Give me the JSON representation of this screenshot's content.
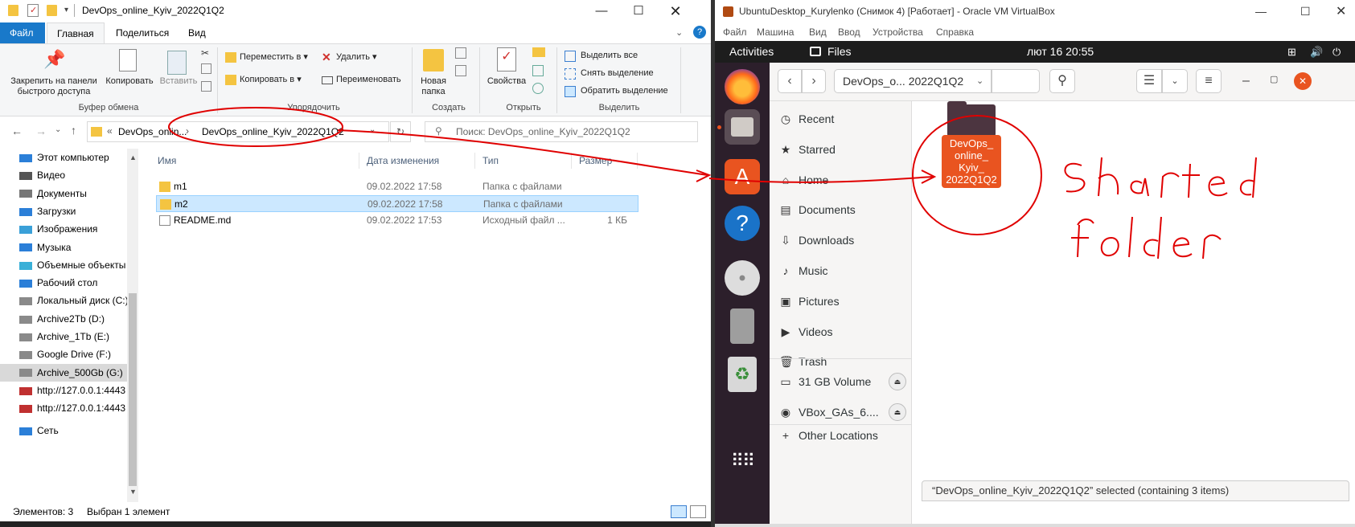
{
  "explorer": {
    "title": "DevOps_online_Kyiv_2022Q1Q2",
    "menu_tabs": [
      "Файл",
      "Главная",
      "Поделиться",
      "Вид"
    ],
    "ribbon": {
      "pin_label_1": "Закрепить на панели",
      "pin_label_2": "быстрого доступа",
      "copy_label": "Копировать",
      "paste_label": "Вставить",
      "move_to": "Переместить в",
      "copy_to": "Копировать в",
      "delete": "Удалить",
      "rename": "Переименовать",
      "new_folder_1": "Новая",
      "new_folder_2": "папка",
      "properties": "Свойства",
      "select_all": "Выделить все",
      "deselect": "Снять выделение",
      "invert": "Обратить выделение",
      "group_clipboard": "Буфер обмена",
      "group_organize": "Упорядочить",
      "group_create": "Создать",
      "group_open": "Открыть",
      "group_select": "Выделить"
    },
    "address": {
      "crumb_1": "DevOps_onlin...",
      "crumb_2": "DevOps_online_Kyiv_2022Q1Q2",
      "search_placeholder": "Поиск: DevOps_online_Kyiv_2022Q1Q2"
    },
    "nav_items": [
      {
        "label": "Этот компьютер",
        "icon": "computer-icon"
      },
      {
        "label": "Видео",
        "icon": "video-icon"
      },
      {
        "label": "Документы",
        "icon": "documents-icon"
      },
      {
        "label": "Загрузки",
        "icon": "downloads-icon"
      },
      {
        "label": "Изображения",
        "icon": "pictures-icon"
      },
      {
        "label": "Музыка",
        "icon": "music-icon"
      },
      {
        "label": "Объемные объекты",
        "icon": "3d-icon"
      },
      {
        "label": "Рабочий стол",
        "icon": "desktop-icon"
      },
      {
        "label": "Локальный диск (C:)",
        "icon": "drive-icon"
      },
      {
        "label": "Archive2Tb (D:)",
        "icon": "drive-icon"
      },
      {
        "label": "Archive_1Tb (E:)",
        "icon": "drive-icon"
      },
      {
        "label": "Google Drive (F:)",
        "icon": "drive-icon"
      },
      {
        "label": "Archive_500Gb (G:)",
        "icon": "drive-icon"
      },
      {
        "label": "http://127.0.0.1:4443",
        "icon": "network-drive-icon"
      },
      {
        "label": "http://127.0.0.1:4443",
        "icon": "network-drive-icon"
      },
      {
        "label": "Сеть",
        "icon": "network-icon"
      }
    ],
    "columns": [
      "Имя",
      "Дата изменения",
      "Тип",
      "Размер"
    ],
    "files": [
      {
        "name": "m1",
        "date": "09.02.2022 17:58",
        "type": "Папка с файлами",
        "size": "",
        "icon": "folder-icon"
      },
      {
        "name": "m2",
        "date": "09.02.2022 17:58",
        "type": "Папка с файлами",
        "size": "",
        "icon": "folder-icon"
      },
      {
        "name": "README.md",
        "date": "09.02.2022 17:53",
        "type": "Исходный файл ...",
        "size": "1 КБ",
        "icon": "file-icon"
      }
    ],
    "status_items": "Элементов: 3",
    "status_selected": "Выбран 1 элемент"
  },
  "vbox": {
    "title": "UbuntuDesktop_Kurylenko (Снимок 4) [Работает] - Oracle VM VirtualBox",
    "menu": [
      "Файл",
      "Машина",
      "Вид",
      "Ввод",
      "Устройства",
      "Справка"
    ],
    "gnome_activities": "Activities",
    "gnome_app": "Files",
    "clock": "лют 16  20:55",
    "path_label": "DevOps_o...  2022Q1Q2",
    "sidebar": [
      {
        "label": "Recent",
        "icon": "clock-icon"
      },
      {
        "label": "Starred",
        "icon": "star-icon"
      },
      {
        "label": "Home",
        "icon": "home-icon"
      },
      {
        "label": "Documents",
        "icon": "documents-icon"
      },
      {
        "label": "Downloads",
        "icon": "downloads-icon"
      },
      {
        "label": "Music",
        "icon": "music-icon"
      },
      {
        "label": "Pictures",
        "icon": "pictures-icon"
      },
      {
        "label": "Videos",
        "icon": "videos-icon"
      },
      {
        "label": "Trash",
        "icon": "trash-icon"
      }
    ],
    "volumes": [
      {
        "label": "31 GB Volume",
        "icon": "drive-icon"
      },
      {
        "label": "VBox_GAs_6....",
        "icon": "disc-icon"
      }
    ],
    "other_locations": "Other Locations",
    "folder_label": "DevOps_ online_ Kyiv_ 2022Q1Q2",
    "folder_lines": [
      "DevOps_",
      "online_",
      "Kyiv_",
      "2022Q1Q2"
    ],
    "status": "“DevOps_online_Kyiv_2022Q1Q2” selected  (containing 3 items)",
    "annotation": "Shared folder"
  },
  "colors": {
    "explorer_selected": "#cce8ff",
    "ribbon_tab_file": "#1979ca",
    "ubuntu_orange": "#e95420",
    "dock_bg": "#2c1f2b",
    "annotation_red": "#e00000"
  }
}
